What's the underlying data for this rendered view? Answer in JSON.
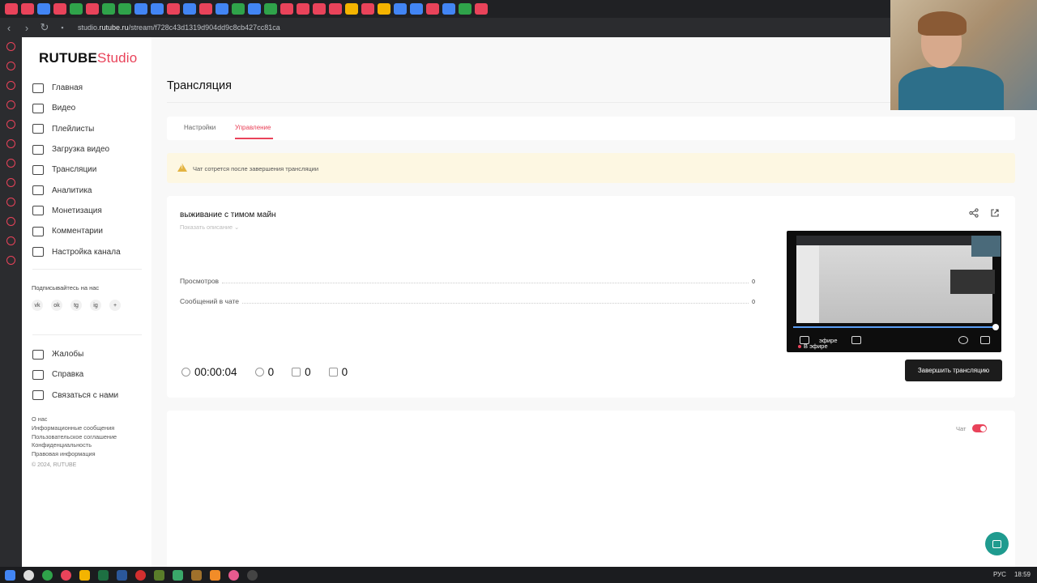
{
  "browser": {
    "url_prefix": "studio.",
    "url_domain": "rutube.ru",
    "url_path": "/stream/f728c43d1319d904dd9c8cb427cc81ca",
    "tab_colors": [
      "#e9435a",
      "#e9435a",
      "#4285f4",
      "#e9435a",
      "#2fa34a",
      "#e9435a",
      "#2fa34a",
      "#2fa34a",
      "#4285f4",
      "#4285f4",
      "#e9435a",
      "#4285f4",
      "#e9435a",
      "#4285f4",
      "#2fa34a",
      "#4285f4",
      "#2fa34a",
      "#e9435a",
      "#e9435a",
      "#e9435a",
      "#e9435a",
      "#f4b400",
      "#e9435a",
      "#f4b400",
      "#4285f4",
      "#4285f4",
      "#e9435a",
      "#4285f4",
      "#2fa34a",
      "#e9435a"
    ]
  },
  "sidebar": {
    "logo_main": "RUTUBE",
    "logo_sub": "Studio",
    "items": [
      {
        "label": "Главная",
        "icon": "home-icon"
      },
      {
        "label": "Видео",
        "icon": "video-icon"
      },
      {
        "label": "Плейлисты",
        "icon": "playlist-icon"
      },
      {
        "label": "Загрузка видео",
        "icon": "upload-icon"
      },
      {
        "label": "Трансляции",
        "icon": "broadcast-icon"
      },
      {
        "label": "Аналитика",
        "icon": "analytics-icon"
      },
      {
        "label": "Монетизация",
        "icon": "money-icon"
      },
      {
        "label": "Комментарии",
        "icon": "comments-icon"
      },
      {
        "label": "Настройка канала",
        "icon": "channel-settings-icon"
      }
    ],
    "follow_label": "Подписывайтесь на нас",
    "social": [
      "vk",
      "ok",
      "tg",
      "ig",
      "+"
    ],
    "items2": [
      {
        "label": "Жалобы",
        "icon": "flag-icon"
      },
      {
        "label": "Справка",
        "icon": "help-icon"
      },
      {
        "label": "Связаться с нами",
        "icon": "contact-icon"
      }
    ],
    "footer_links": [
      "О нас",
      "Информационные сообщения",
      "Пользовательское соглашение",
      "Конфиденциальность",
      "Правовая информация"
    ],
    "copyright": "© 2024, RUTUBE"
  },
  "main": {
    "page_title": "Трансляция",
    "tabs": [
      {
        "label": "Настройки",
        "active": false
      },
      {
        "label": "Управление",
        "active": true
      }
    ],
    "warning": "Чат сотрется после завершения трансляции",
    "stream": {
      "title": "выживание с тимом майн",
      "show_description": "Показать описание",
      "stats": [
        {
          "label": "Просмотров",
          "value": "0"
        },
        {
          "label": "Сообщений в чате",
          "value": "0"
        }
      ],
      "duration": "00:00:04",
      "viewers": "0",
      "likes": "0",
      "dislikes": "0",
      "player_live_label": "В эфире",
      "player_overlay_text": "эфире",
      "end_button": "Завершить трансляцию"
    },
    "chat_label": "Чат",
    "chat_enabled": true
  },
  "taskbar": {
    "tray_lang": "РУС",
    "tray_time": "18:59",
    "accent": "#e9435a"
  }
}
